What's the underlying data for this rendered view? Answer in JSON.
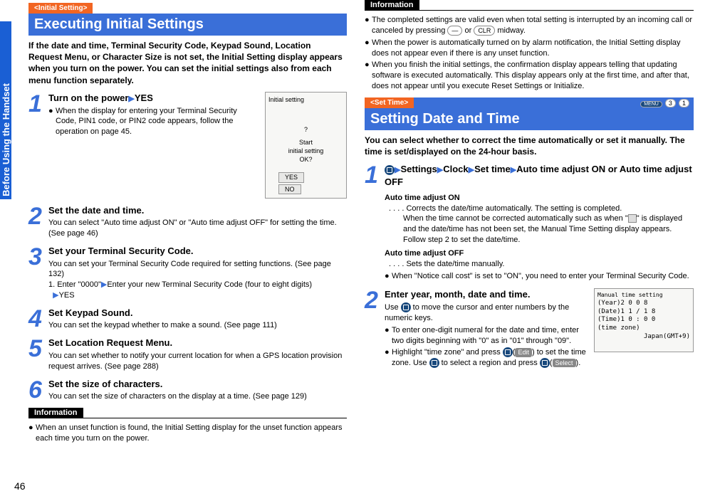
{
  "sideTab": "Before Using the Handset",
  "pageNumber": "46",
  "left": {
    "tag": "<Initial Setting>",
    "title": "Executing Initial Settings",
    "intro": "If the date and time, Terminal Security Code, Keypad Sound, Location Request Menu, or Character Size is not set, the Initial Setting display appears when you turn on the power. You can set the initial settings also from each menu function separately.",
    "steps": [
      {
        "n": "1",
        "title_a": "Turn on the power",
        "title_b": "YES",
        "bullets": [
          "When the display for entering your Terminal Security Code, PIN1 code, or PIN2 code appears, follow the operation on page 45."
        ],
        "shot": {
          "l1": "Initial setting",
          "l2": "Start",
          "l3": "initial setting",
          "l4": "OK?",
          "yes": "YES",
          "no": "NO"
        }
      },
      {
        "n": "2",
        "title_a": "Set the date and time.",
        "body": "You can select \"Auto time adjust ON\" or \"Auto time adjust OFF\" for setting the time. (See page 46)"
      },
      {
        "n": "3",
        "title_a": "Set your Terminal Security Code.",
        "body": "You can set your Terminal Security Code required for setting functions. (See page 132)",
        "sub_a": "1. Enter \"0000\"",
        "sub_b": "Enter your new Terminal Security Code (four to eight digits)",
        "sub_c": "YES"
      },
      {
        "n": "4",
        "title_a": "Set Keypad Sound.",
        "body": "You can set the keypad whether to make a sound. (See page 111)"
      },
      {
        "n": "5",
        "title_a": "Set Location Request Menu.",
        "body": "You can set whether to notify your current location for when a GPS location provision request arrives. (See page 288)"
      },
      {
        "n": "6",
        "title_a": "Set the size of characters.",
        "body": "You can set the size of characters on the display at a time. (See page 129)"
      }
    ],
    "info_label": "Information",
    "info": [
      "When an unset function is found, the Initial Setting display for the unset function appears each time you turn on the power."
    ]
  },
  "right": {
    "info_label": "Information",
    "info": [
      {
        "a": "The completed settings are valid even when total setting is interrupted by an incoming call or canceled by pressing ",
        "btn1": "—",
        "b": " or ",
        "btn2": "CLR",
        "c": " midway."
      },
      {
        "a": "When the power is automatically turned on by alarm notification, the Initial Setting display does not appear even if there is any unset function."
      },
      {
        "a": "When you finish the initial settings, the confirmation display appears telling that updating software is executed automatically. This display appears only at the first time, and after that, does not appear until you execute Reset Settings or Initialize."
      }
    ],
    "tag": "<Set Time>",
    "title": "Setting Date and Time",
    "menu_codes": {
      "menu": "MENU",
      "c1": "3",
      "c2": "1"
    },
    "intro": "You can select whether to correct the time automatically or set it manually. The time is set/displayed on the 24-hour basis.",
    "step1": {
      "n": "1",
      "chain": {
        "settings": "Settings",
        "clock": "Clock",
        "settime": "Set time",
        "auto": "Auto time adjust ON or Auto time adjust OFF"
      },
      "on_label": "Auto time adjust ON",
      "on_dots": ". . . . Corrects the date/time automatically. The setting is completed.",
      "on_body": "When the time cannot be corrected automatically such as when \"",
      "on_body2": "\" is displayed and the date/time has not been set, the Manual Time Setting display appears. Follow step 2 to set the date/time.",
      "off_label": "Auto time adjust OFF",
      "off_dots": ". . . . Sets the date/time manually.",
      "note": "When \"Notice call cost\" is set to \"ON\", you need to enter your Terminal Security Code."
    },
    "step2": {
      "n": "2",
      "title": "Enter year, month, date and time.",
      "line1a": "Use ",
      "line1b": " to move the cursor and enter numbers by the numeric keys.",
      "b1": "To enter one-digit numeral for the date and time, enter two digits beginning with \"0\" as in \"01\" through \"09\".",
      "b2a": "Highlight \"time zone\" and press ",
      "b2_edit": "Edit",
      "b2b": ") to set the time zone. Use ",
      "b2_select": "Select",
      "b2c": " to select a region and press ",
      "b2d": ").",
      "shot": {
        "l0": "Manual time setting",
        "l1": "(Year)2 0 0 8",
        "l2": "(Date)1 1 / 1 8",
        "l3": "(Time)1 0 : 0 0",
        "l4": "(time zone)",
        "l5": "Japan(GMT+9)"
      }
    }
  }
}
